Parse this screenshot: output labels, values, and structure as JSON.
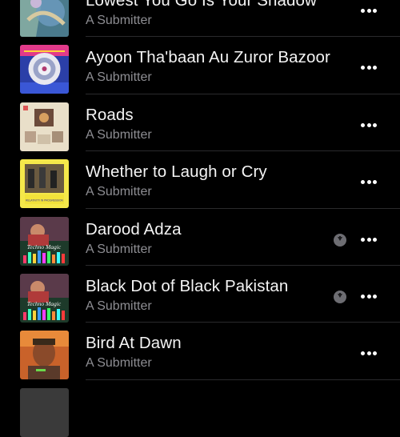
{
  "tracks": [
    {
      "title": "Lowest You Go Is Your Shadow",
      "subtitle": "A Submitter",
      "downloaded": false,
      "art_icon": "abstract-art-icon"
    },
    {
      "title": "Ayoon Tha'baan Au Zuror Bazoor",
      "subtitle": "A Submitter",
      "downloaded": false,
      "art_icon": "mandala-art-icon"
    },
    {
      "title": "Roads",
      "subtitle": "A Submitter",
      "downloaded": false,
      "art_icon": "collage-art-icon"
    },
    {
      "title": "Whether to Laugh or Cry",
      "subtitle": "A Submitter",
      "downloaded": false,
      "art_icon": "relativity-art-icon"
    },
    {
      "title": "Darood Adza",
      "subtitle": "A Submitter",
      "downloaded": true,
      "art_icon": "techno-magic-art-icon"
    },
    {
      "title": "Black Dot of Black Pakistan",
      "subtitle": "A Submitter",
      "downloaded": true,
      "art_icon": "techno-magic-art-icon"
    },
    {
      "title": "Bird At Dawn",
      "subtitle": "A Submitter",
      "downloaded": false,
      "art_icon": "portrait-art-icon"
    }
  ],
  "art_text": {
    "techno_magic": "Techno Magic",
    "relativity": "RELATIVITY IN PROGRESSION"
  },
  "icons": {
    "more": "more-icon",
    "download": "download-status-icon"
  },
  "colors": {
    "background": "#000000",
    "title": "#f4f4f4",
    "subtitle": "#8e8e93",
    "separator": "#2a2a2c"
  }
}
